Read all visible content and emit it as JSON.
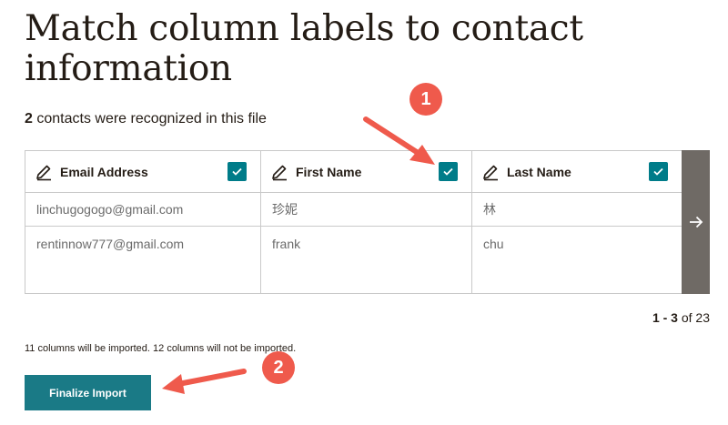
{
  "heading": "Match column labels to contact information",
  "recognized": {
    "count": "2",
    "text": "contacts were recognized in this file"
  },
  "columns": [
    {
      "label": "Email Address",
      "cells": [
        "linchugogogo@gmail.com",
        "rentinnow777@gmail.com"
      ]
    },
    {
      "label": "First Name",
      "cells": [
        "珍妮",
        "frank"
      ]
    },
    {
      "label": "Last Name",
      "cells": [
        "林",
        "chu"
      ]
    }
  ],
  "pager": {
    "range": "1 - 3",
    "of_text": "of 23"
  },
  "columns_note": "11 columns will be imported. 12 columns will not be imported.",
  "finalize_label": "Finalize Import",
  "annotations": {
    "badge_1": "1",
    "badge_2": "2"
  },
  "colors": {
    "accent": "#007c89",
    "button": "#1a7a86",
    "annotation": "#ef5a4c",
    "next_panel": "#6f6a65"
  },
  "icons": {
    "edit": "pencil-icon",
    "checked": "checkmark-icon",
    "next": "arrow-right-icon"
  }
}
